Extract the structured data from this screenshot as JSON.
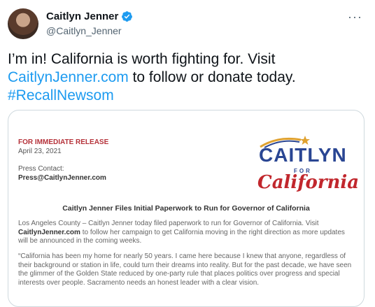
{
  "tweet": {
    "display_name": "Caitlyn Jenner",
    "handle": "@Caitlyn_Jenner",
    "more_icon": "···",
    "text_part1": "I’m in! California is worth fighting for. Visit ",
    "link": "CaitlynJenner.com",
    "text_part2": " to follow or donate today.",
    "hashtag": "#RecallNewsom"
  },
  "release": {
    "label": "FOR IMMEDIATE RELEASE",
    "date": "April 23, 2021",
    "press_contact_label": "Press Contact:",
    "press_email": "Press@CaitlynJenner.com",
    "logo_top": "CAITLYN",
    "logo_for": "FOR",
    "logo_bottom": "California",
    "headline": "Caitlyn Jenner Files Initial Paperwork to Run for Governor of California",
    "para1_start": "Los Angeles County – Caitlyn Jenner today filed paperwork to run for Governor of California. Visit ",
    "para1_link": "CaitlynJenner.com",
    "para1_end": " to follow her campaign to get California moving in the right direction as more updates will be announced in the coming weeks.",
    "para2": "“California has been my home for nearly 50 years. I came here because I knew that anyone, regardless of their background or station in life, could turn their dreams into reality. But for the past decade, we have seen the glimmer of the Golden State reduced by one-party rule that places politics over progress and special interests over people. Sacramento needs an honest leader with a clear vision."
  },
  "colors": {
    "link": "#1d9bf0",
    "verified": "#1d9bf0",
    "release_red": "#b5323a",
    "logo_blue": "#2a4693",
    "logo_red": "#c1272d"
  }
}
